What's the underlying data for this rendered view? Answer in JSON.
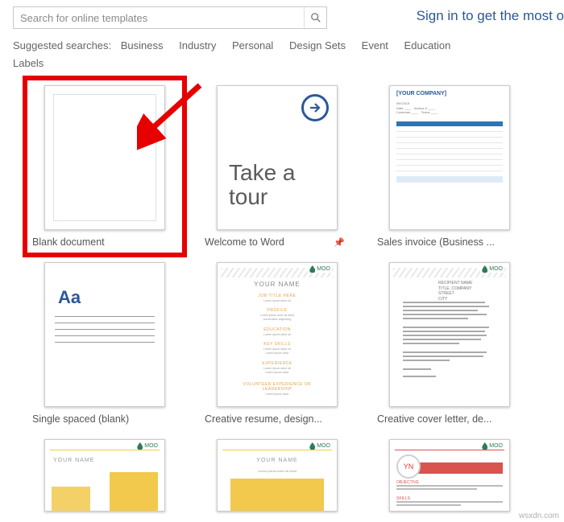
{
  "search": {
    "placeholder": "Search for online templates"
  },
  "signin_text": "Sign in to get the most o",
  "suggested": {
    "label": "Suggested searches:",
    "items": [
      "Business",
      "Industry",
      "Personal",
      "Design Sets",
      "Event",
      "Education",
      "Labels"
    ]
  },
  "templates": [
    {
      "caption": "Blank document",
      "pinned": false
    },
    {
      "caption": "Welcome to Word",
      "pinned": true,
      "tour_text": "Take a tour"
    },
    {
      "caption": "Sales invoice (Business ...",
      "pinned": false,
      "company": "[YOUR COMPANY]"
    },
    {
      "caption": "Single spaced (blank)",
      "pinned": false,
      "aa": "Aa"
    },
    {
      "caption": "Creative resume, design...",
      "pinned": false,
      "name": "YOUR NAME",
      "moo": "MOO"
    },
    {
      "caption": "Creative cover letter, de...",
      "pinned": false,
      "recipient": "RECIPIENT NAME",
      "moo": "MOO"
    },
    {
      "caption": "",
      "pinned": false,
      "name": "YOUR NAME",
      "moo": "MOO"
    },
    {
      "caption": "",
      "pinned": false,
      "name": "YOUR NAME",
      "moo": "MOO"
    },
    {
      "caption": "",
      "pinned": false,
      "initials": "YN",
      "moo": "MOO"
    }
  ],
  "watermark": "wsxdn.com"
}
